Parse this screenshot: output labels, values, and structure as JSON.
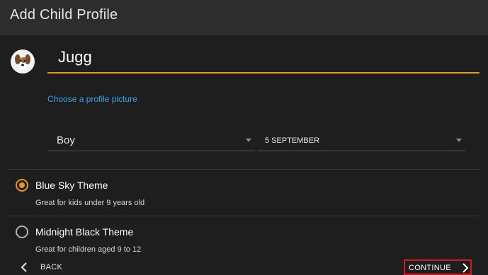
{
  "header": {
    "title": "Add Child Profile"
  },
  "profile": {
    "name": "Jugg",
    "avatar_icon": "puppy-avatar-icon",
    "choose_picture_label": "Choose a profile picture"
  },
  "gender_select": {
    "value": "Boy"
  },
  "birthday_select": {
    "value": "5 SEPTEMBER"
  },
  "themes": [
    {
      "label": "Blue Sky Theme",
      "description": "Great for kids under 9 years old",
      "selected": true
    },
    {
      "label": "Midnight Black Theme",
      "description": "Great for children aged 9 to 12",
      "selected": false
    }
  ],
  "footer": {
    "back_label": "BACK",
    "continue_label": "CONTINUE"
  },
  "colors": {
    "accent": "#e8961e",
    "link": "#33a6e8",
    "highlight_border": "#e0141e",
    "background": "#1e1e1e",
    "header_background": "#2d2d2d"
  }
}
